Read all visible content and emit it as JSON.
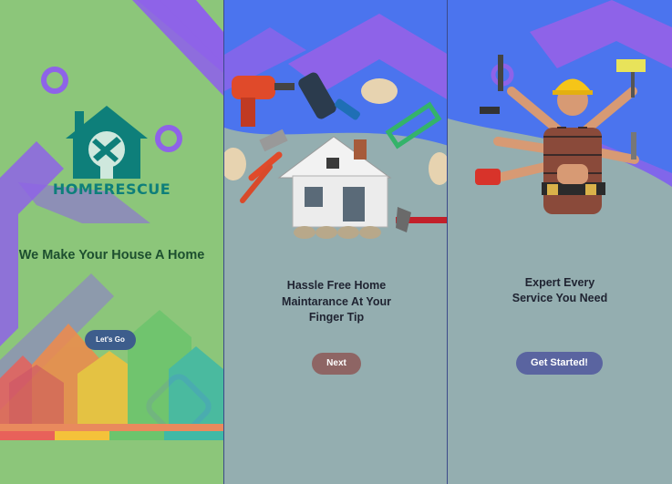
{
  "screens": [
    {
      "brand_name": "HOMERESCUE",
      "tagline": "We Make Your House A Home",
      "button_label": "Let's Go"
    },
    {
      "headline_line1": "Hassle Free Home",
      "headline_line2": "Maintarance At Your",
      "headline_line3": "Finger Tip",
      "button_label": "Next"
    },
    {
      "headline_line1": "Expert Every",
      "headline_line2": "Service You Need",
      "button_label": "Get Started!"
    }
  ],
  "colors": {
    "screen1_bg": "#8cc67a",
    "screen2_3_top_bg": "#4b74ee",
    "accent_purple": "#8e63e8",
    "bottom_bg": "#94aeb0",
    "brand_teal": "#0e7f7a",
    "tagline_green": "#1d4f2f",
    "next_button": "#8e6564",
    "start_button": "#5a64a0",
    "letsgo_button": "#3d5d8c"
  }
}
